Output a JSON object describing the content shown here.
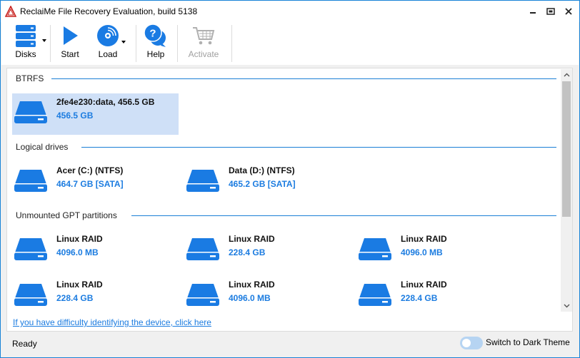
{
  "window": {
    "title": "ReclaiMe File Recovery Evaluation, build 5138"
  },
  "toolbar": {
    "disks_label": "Disks",
    "start_label": "Start",
    "load_label": "Load",
    "help_label": "Help",
    "activate_label": "Activate",
    "activate_enabled": false
  },
  "sections": [
    {
      "title": "BTRFS",
      "drives": [
        {
          "name": "2fe4e230:data, 456.5 GB",
          "size": "456.5 GB",
          "selected": true
        }
      ]
    },
    {
      "title": "Logical drives",
      "drives": [
        {
          "name": "Acer (C:) (NTFS)",
          "size": "464.7 GB [SATA]"
        },
        {
          "name": "Data (D:) (NTFS)",
          "size": "465.2 GB [SATA]"
        }
      ]
    },
    {
      "title": "Unmounted GPT partitions",
      "drives": [
        {
          "name": "Linux RAID",
          "size": "4096.0 MB"
        },
        {
          "name": "Linux RAID",
          "size": "228.4 GB"
        },
        {
          "name": "Linux RAID",
          "size": "4096.0 MB"
        },
        {
          "name": "Linux RAID",
          "size": "228.4 GB"
        },
        {
          "name": "Linux RAID",
          "size": "4096.0 MB"
        },
        {
          "name": "Linux RAID",
          "size": "228.4 GB"
        }
      ]
    }
  ],
  "help_link": "If you have difficulty identifying the device, click here",
  "statusbar": {
    "status": "Ready",
    "dark_theme_label": "Switch to Dark Theme",
    "dark_theme_on": false
  },
  "colors": {
    "accent": "#1c7ce0",
    "drive_icon": "#1a7be3",
    "selection": "#cfe0f7",
    "section_line": "#1b7fd6"
  }
}
